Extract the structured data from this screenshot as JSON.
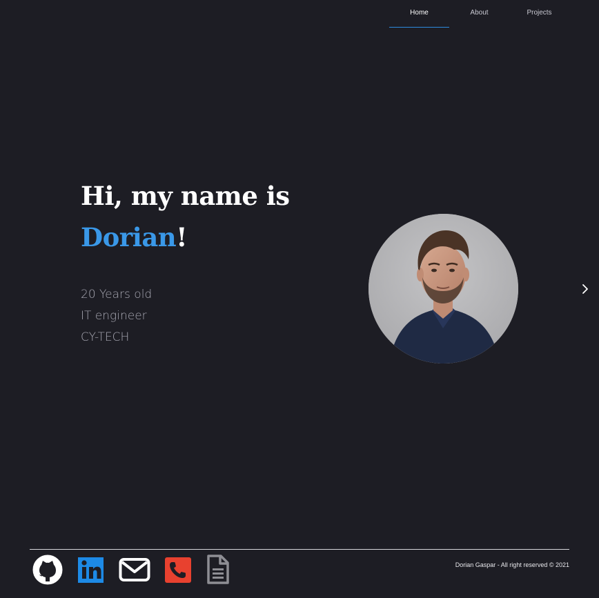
{
  "nav": {
    "items": [
      {
        "label": "Home",
        "active": true
      },
      {
        "label": "About",
        "active": false
      },
      {
        "label": "Projects",
        "active": false
      }
    ]
  },
  "hero": {
    "line1": "Hi, my name is",
    "name": "Dorian",
    "exclaim": "!"
  },
  "facts": [
    "20 Years old",
    "IT engineer",
    "CY-TECH"
  ],
  "icons": {
    "github": "github-icon",
    "linkedin": "linkedin-icon",
    "email": "email-icon",
    "phone": "phone-icon",
    "resume": "document-icon",
    "next": "chevron-right-icon"
  },
  "colors": {
    "background": "#1d1d24",
    "accent": "#3a98e8",
    "linkedin": "#1d8ae6",
    "phone": "#e8412f",
    "document": "#8e8e94"
  },
  "footer": {
    "copyright": "Dorian Gaspar - All right reserved © 2021"
  }
}
